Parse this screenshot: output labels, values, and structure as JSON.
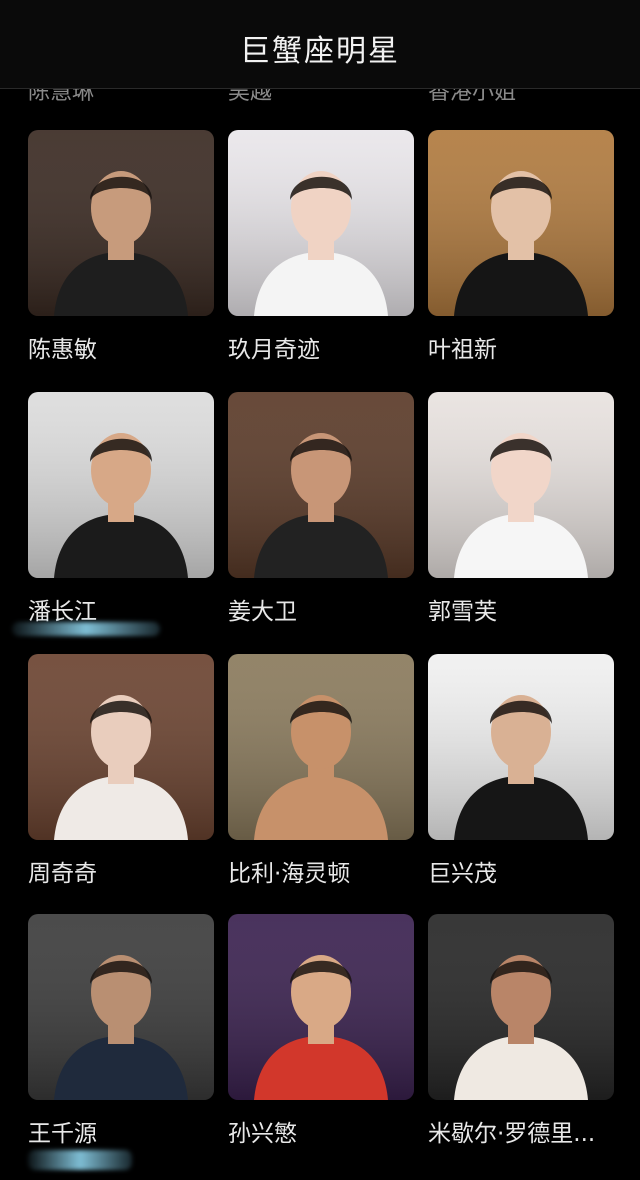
{
  "header": {
    "title": "巨蟹座明星"
  },
  "cut_labels": [
    "陈慧琳",
    "吴越",
    "香港小姐"
  ],
  "stars": [
    {
      "name": "陈惠敏",
      "bg": "#3a2a22",
      "skin": "#c79b7c",
      "cloth": "#1e1e1e"
    },
    {
      "name": "玖月奇迹",
      "bg": "#e9e6ea",
      "skin": "#f0d3c4",
      "cloth": "#f4f4f4"
    },
    {
      "name": "叶祖新",
      "bg": "#b07a3e",
      "skin": "#e3c1a7",
      "cloth": "#151515"
    },
    {
      "name": "潘长江",
      "bg": "#dcdcdc",
      "skin": "#d7a887",
      "cloth": "#1b1b1b"
    },
    {
      "name": "姜大卫",
      "bg": "#5a3a28",
      "skin": "#c89677",
      "cloth": "#222"
    },
    {
      "name": "郭雪芙",
      "bg": "#e8e2df",
      "skin": "#f1d6c9",
      "cloth": "#f6f6f6"
    },
    {
      "name": "周奇奇",
      "bg": "#6b4330",
      "skin": "#e9cdbd",
      "cloth": "#efeae6"
    },
    {
      "name": "比利·海灵顿",
      "bg": "#8a7a5c",
      "skin": "#c7916a",
      "cloth": "#c7916a"
    },
    {
      "name": "巨兴茂",
      "bg": "#f0f0f0",
      "skin": "#d9b194",
      "cloth": "#161616"
    },
    {
      "name": "王千源",
      "bg": "#3b3b3b",
      "skin": "#b98f72",
      "cloth": "#1f2a3c"
    },
    {
      "name": "孙兴慜",
      "bg": "#3a214f",
      "skin": "#d9a986",
      "cloth": "#d2372b"
    },
    {
      "name": "米歇尔·罗德里...",
      "bg": "#262626",
      "skin": "#b98568",
      "cloth": "#efe9e2"
    }
  ]
}
